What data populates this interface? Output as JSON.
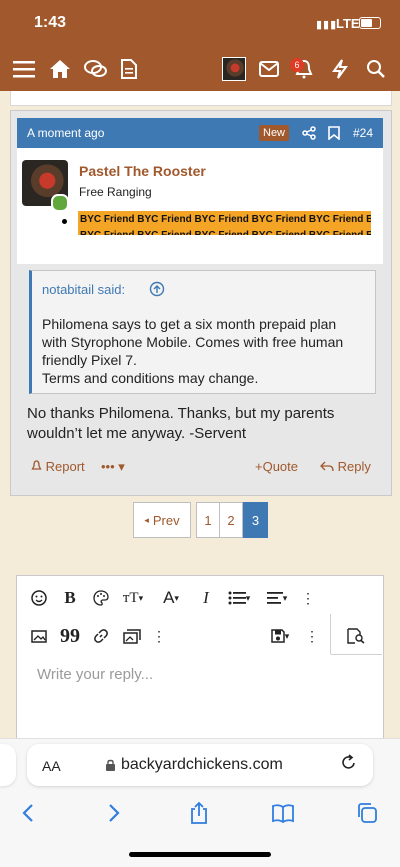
{
  "status_bar": {
    "time": "1:43",
    "network": "LTE"
  },
  "nav": {
    "icons": [
      "menu-icon",
      "home-icon",
      "chat-icon",
      "document-icon",
      "avatar",
      "mail-icon",
      "bell-icon",
      "lightning-icon",
      "search-icon"
    ],
    "alert_count": "6"
  },
  "post": {
    "timestamp": "A moment ago",
    "new_label": "New",
    "post_number": "#24",
    "username": "Pastel The Rooster",
    "user_title": "Free Ranging",
    "banner_text": "BYC Friend BYC Friend BYC Friend BYC Friend BYC Friend BYC Friend",
    "quote_author": "notabitail said:",
    "quote_body": "Philomena says to get a six month prepaid plan with Styrophone Mobile. Comes with free human friendly Pixel 7.\nTerms and conditions may change.",
    "reply_text": "No thanks Philomena. Thanks, but my parents wouldn’t let me anyway. -Servent",
    "report_label": "Report",
    "more_label": "•••",
    "quote_label": "Quote",
    "reply_label": "Reply"
  },
  "pagination": {
    "prev_label": "Prev",
    "pages": [
      "1",
      "2",
      "3"
    ],
    "active_page": "3"
  },
  "editor": {
    "placeholder": "Write your reply..."
  },
  "safari": {
    "aa_label": "AA",
    "url": "backyardchickens.com"
  },
  "colors": {
    "brand_brown": "#a0582c",
    "accent_blue": "#3f79b3",
    "banner_orange": "#f4a526"
  }
}
